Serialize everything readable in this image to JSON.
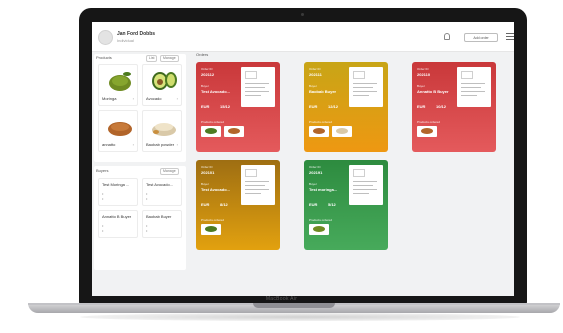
{
  "device": {
    "brand": "MacBook Air"
  },
  "header": {
    "user_name": "Jan Ford Dobbs",
    "user_role": "Individual",
    "add_button": "Add order"
  },
  "products": {
    "title": "Products",
    "toggle_left": "List",
    "toggle_right": "Manage",
    "items": [
      {
        "label": "Moringa",
        "icon": "moringa-powder-icon"
      },
      {
        "label": "Avocado",
        "icon": "avocado-icon"
      },
      {
        "label": "annatto",
        "icon": "annatto-powder-icon"
      },
      {
        "label": "Baobab powder",
        "icon": "baobab-powder-icon"
      }
    ]
  },
  "buyers": {
    "title": "Buyers",
    "toggle": "Manage",
    "items": [
      {
        "label": "Test Moringa ..."
      },
      {
        "label": "Test Avocado..."
      },
      {
        "label": "Annatto B Buyer"
      },
      {
        "label": "Baobab Buyer"
      }
    ]
  },
  "orders": {
    "title": "Orders",
    "cards": [
      {
        "color": "red",
        "order_label": "Order ID",
        "order_id": "202112",
        "buyer_label": "Buyer",
        "buyer": "Test Avocado...",
        "currency": "EUR",
        "due": "15/12",
        "products_label": "Products ordered"
      },
      {
        "color": "orange",
        "order_label": "Order ID",
        "order_id": "202111",
        "buyer_label": "Buyer",
        "buyer": "Baobab Buyer",
        "currency": "EUR",
        "due": "12/12",
        "products_label": "Products ordered"
      },
      {
        "color": "red",
        "order_label": "Order ID",
        "order_id": "202110",
        "buyer_label": "Buyer",
        "buyer": "Annatto B Buyer",
        "currency": "EUR",
        "due": "10/12",
        "products_label": "Products ordered"
      },
      {
        "color": "goldbrown",
        "order_label": "Order ID",
        "order_id": "202101",
        "buyer_label": "Buyer",
        "buyer": "Test Avocado...",
        "currency": "EUR",
        "due": "8/12",
        "products_label": "Products ordered"
      },
      {
        "color": "green",
        "order_label": "Order ID",
        "order_id": "202191",
        "buyer_label": "Buyer",
        "buyer": "Test moringa...",
        "currency": "EUR",
        "due": "5/12",
        "products_label": "Products ordered"
      }
    ]
  }
}
